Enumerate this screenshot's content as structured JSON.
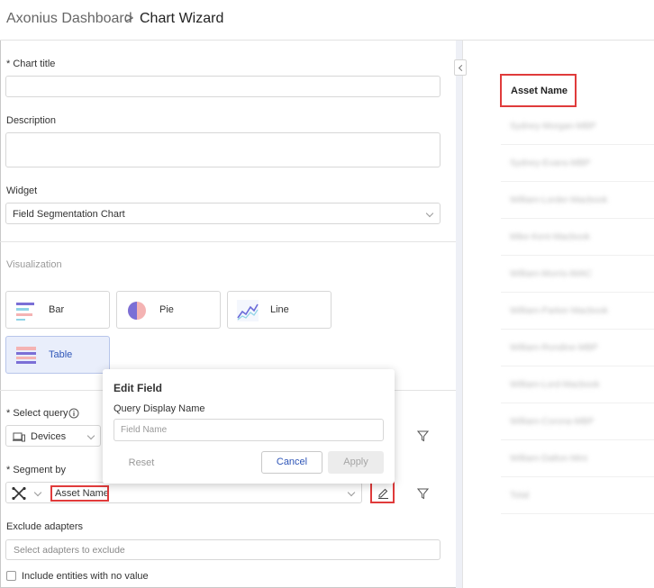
{
  "header": {
    "breadcrumb": "Axonius Dashboard",
    "separator": ">",
    "title": "Chart Wizard"
  },
  "form": {
    "chart_title_label": "* Chart title",
    "chart_title_value": "",
    "description_label": "Description",
    "description_value": "",
    "widget_label": "Widget",
    "widget_value": "Field Segmentation Chart",
    "visualization_label": "Visualization",
    "viz_options": [
      {
        "label": "Bar",
        "icon": "bar-chart-icon"
      },
      {
        "label": "Pie",
        "icon": "pie-chart-icon"
      },
      {
        "label": "Line",
        "icon": "line-chart-icon"
      },
      {
        "label": "Table",
        "icon": "table-icon",
        "selected": true
      }
    ],
    "select_query_label": "* Select query",
    "query_value": "Devices",
    "segment_by_label": "* Segment by",
    "segment_value": "Asset Name",
    "exclude_label": "Exclude adapters",
    "exclude_placeholder": "Select adapters to exclude",
    "include_empty_label": "Include entities with no value"
  },
  "popup": {
    "title": "Edit Field",
    "field_label": "Query Display Name",
    "field_placeholder": "Field Name",
    "reset_label": "Reset",
    "cancel_label": "Cancel",
    "apply_label": "Apply"
  },
  "preview": {
    "column_header": "Asset Name",
    "rows": [
      "Sydney-Morgan-MBP",
      "Sydney-Evans-MBP",
      "William-Lorder-Macbook",
      "Mike-Kent-Macbook",
      "William-Morris-iMAC",
      "William-Parker-Macbook",
      "William-Rondine-MBP",
      "William-Lord-Macbook",
      "William-Corona-MBP",
      "William-Dalton-Mini",
      "Total"
    ]
  },
  "colors": {
    "highlight": "#e03b3b",
    "accent": "#2f56b8",
    "selected_tile": "#e9eefb"
  }
}
